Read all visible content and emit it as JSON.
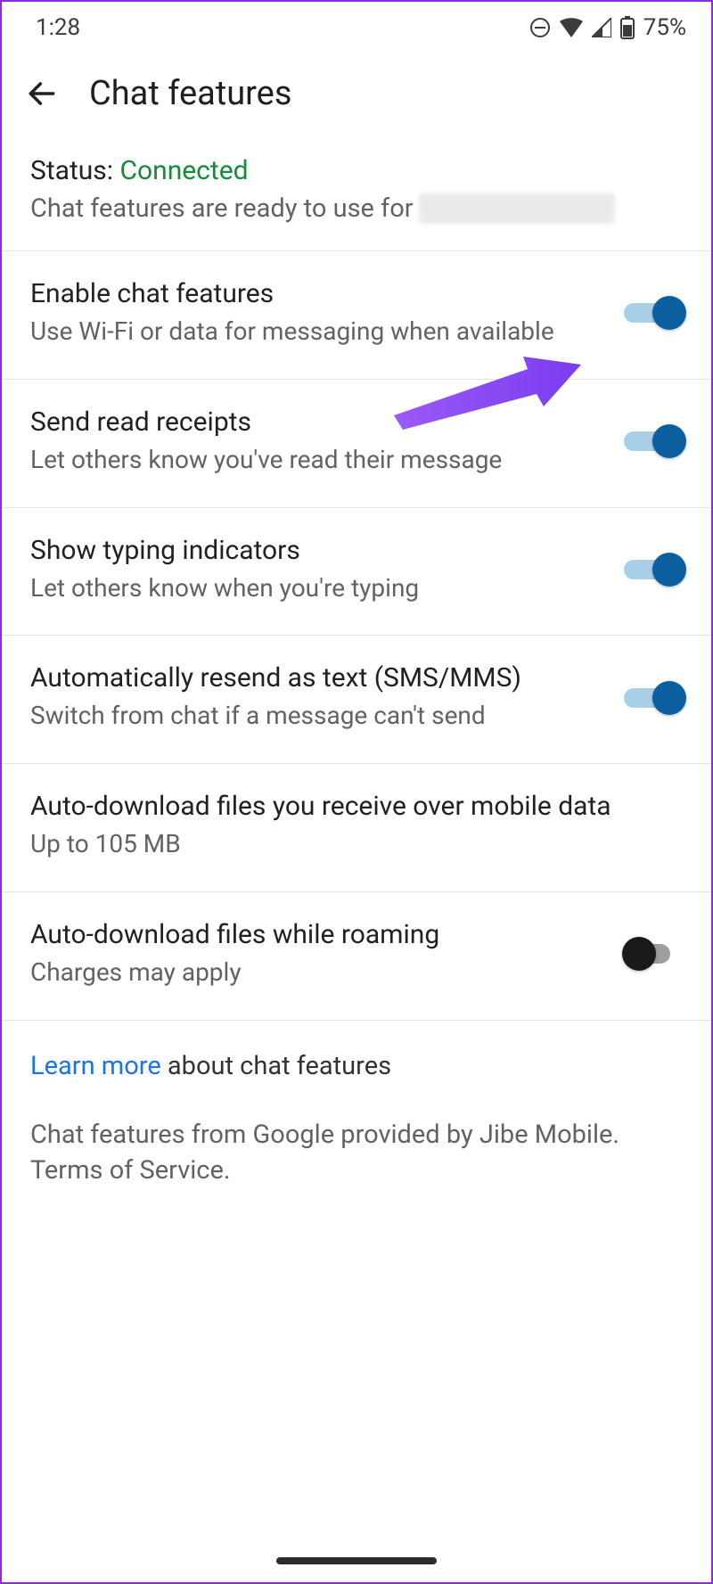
{
  "statusbar": {
    "time": "1:28",
    "battery_pct": "75%"
  },
  "appbar": {
    "title": "Chat features"
  },
  "status": {
    "label": "Status:",
    "value": "Connected",
    "subtitle": "Chat features are ready to use for"
  },
  "rows": [
    {
      "title": "Enable chat features",
      "sub": "Use Wi-Fi or data for messaging when available",
      "toggle": "on"
    },
    {
      "title": "Send read receipts",
      "sub": "Let others know you've read their message",
      "toggle": "on"
    },
    {
      "title": "Show typing indicators",
      "sub": "Let others know when you're typing",
      "toggle": "on"
    },
    {
      "title": "Automatically resend as text (SMS/MMS)",
      "sub": "Switch from chat if a message can't send",
      "toggle": "on"
    },
    {
      "title": "Auto-download files you receive over mobile data",
      "sub": "Up to 105 MB",
      "toggle": null
    },
    {
      "title": "Auto-download files while roaming",
      "sub": "Charges may apply",
      "toggle": "off"
    }
  ],
  "footer": {
    "link_text": "Learn more",
    "link_rest": " about chat features",
    "provider": "Chat features from Google provided by Jibe Mobile. Terms of Service."
  }
}
